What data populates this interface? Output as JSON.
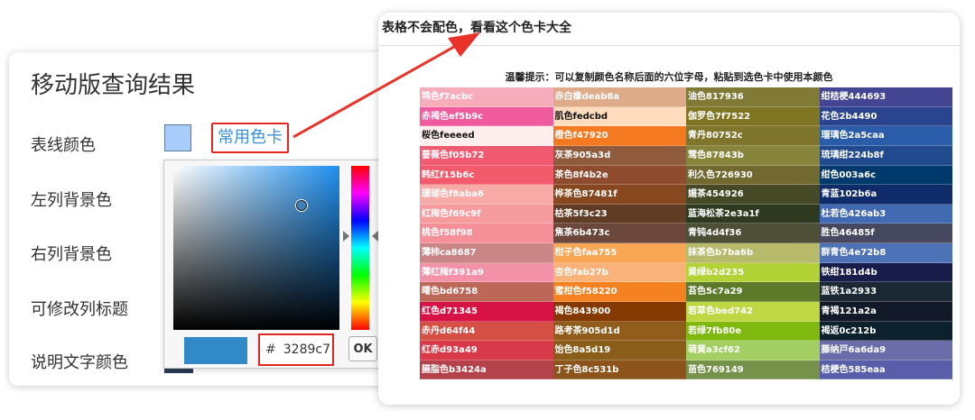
{
  "left_panel": {
    "title": "移动版查询结果",
    "labels": [
      "表线颜色",
      "左列背景色",
      "右列背景色",
      "可修改列标题",
      "说明文字颜色"
    ],
    "common_colors_link": "常用色卡",
    "picker": {
      "hash": "#",
      "hex_value": "3289c7",
      "ok_label": "OK",
      "preview_color": "#3289c7"
    }
  },
  "right_panel": {
    "title": "表格不会配色，看看这个色卡大全",
    "tip": "温馨提示：可以复制颜色名称后面的六位字母，粘贴到选色卡中使用本颜色",
    "columns": [
      [
        {
          "label": "鸨色f7acbc",
          "color": "#f7acbc"
        },
        {
          "label": "赤褐色ef5b9c",
          "color": "#ef5b9c"
        },
        {
          "label": "桜色feeeed",
          "color": "#feeeed",
          "dark": true
        },
        {
          "label": "蔷薇色f05b72",
          "color": "#f05b72"
        },
        {
          "label": "韩红f15b6c",
          "color": "#f15b6c"
        },
        {
          "label": "珊瑚色f8aba6",
          "color": "#f8aba6"
        },
        {
          "label": "红梅色f69c9f",
          "color": "#f69c9f"
        },
        {
          "label": "桃色f58f98",
          "color": "#f58f98"
        },
        {
          "label": "薄柿ca8687",
          "color": "#ca8687"
        },
        {
          "label": "薄红梅f391a9",
          "color": "#f391a9"
        },
        {
          "label": "曙色bd6758",
          "color": "#bd6758"
        },
        {
          "label": "红色d71345",
          "color": "#d71345"
        },
        {
          "label": "赤丹d64f44",
          "color": "#d64f44"
        },
        {
          "label": "红赤d93a49",
          "color": "#d93a49"
        },
        {
          "label": "臙脂色b3424a",
          "color": "#b3424a"
        }
      ],
      [
        {
          "label": "赤白橡deab8a",
          "color": "#deab8a"
        },
        {
          "label": "肌色fedcbd",
          "color": "#fedcbd",
          "dark": true
        },
        {
          "label": "橙色f47920",
          "color": "#f47920"
        },
        {
          "label": "灰茶905a3d",
          "color": "#905a3d"
        },
        {
          "label": "茶色8f4b2e",
          "color": "#8f4b2e"
        },
        {
          "label": "桦茶色87481f",
          "color": "#87481f"
        },
        {
          "label": "枯茶5f3c23",
          "color": "#5f3c23"
        },
        {
          "label": "焦茶6b473c",
          "color": "#6b473c"
        },
        {
          "label": "柑子色faa755",
          "color": "#faa755"
        },
        {
          "label": "杏色fab27b",
          "color": "#fab27b"
        },
        {
          "label": "蜜柑色f58220",
          "color": "#f58220"
        },
        {
          "label": "褐色843900",
          "color": "#843900"
        },
        {
          "label": "路考茶905d1d",
          "color": "#905d1d"
        },
        {
          "label": "饴色8a5d19",
          "color": "#8a5d19"
        },
        {
          "label": "丁子色8c531b",
          "color": "#8c531b"
        }
      ],
      [
        {
          "label": "油色817936",
          "color": "#817936"
        },
        {
          "label": "伽罗色7f7522",
          "color": "#7f7522"
        },
        {
          "label": "青丹80752c",
          "color": "#80752c"
        },
        {
          "label": "莺色87843b",
          "color": "#87843b"
        },
        {
          "label": "利久色726930",
          "color": "#726930"
        },
        {
          "label": "媚茶454926",
          "color": "#454926"
        },
        {
          "label": "蓝海松茶2e3a1f",
          "color": "#2e3a1f"
        },
        {
          "label": "青钝4d4f36",
          "color": "#4d4f36"
        },
        {
          "label": "抹茶色b7ba6b",
          "color": "#b7ba6b"
        },
        {
          "label": "黄绿b2d235",
          "color": "#b2d235"
        },
        {
          "label": "苔色5c7a29",
          "color": "#5c7a29"
        },
        {
          "label": "若草色bed742",
          "color": "#bed742"
        },
        {
          "label": "若绿7fb80e",
          "color": "#7fb80e"
        },
        {
          "label": "萌黄a3cf62",
          "color": "#a3cf62"
        },
        {
          "label": "苗色769149",
          "color": "#769149"
        }
      ],
      [
        {
          "label": "绀桔梗444693",
          "color": "#444693"
        },
        {
          "label": "花色2b4490",
          "color": "#2b4490"
        },
        {
          "label": "瑠璃色2a5caa",
          "color": "#2a5caa"
        },
        {
          "label": "琉璃绀224b8f",
          "color": "#224b8f"
        },
        {
          "label": "绀色003a6c",
          "color": "#003a6c"
        },
        {
          "label": "青蓝102b6a",
          "color": "#102b6a"
        },
        {
          "label": "杜若色426ab3",
          "color": "#426ab3"
        },
        {
          "label": "胜色46485f",
          "color": "#46485f"
        },
        {
          "label": "群青色4e72b8",
          "color": "#4e72b8"
        },
        {
          "label": "铁绀181d4b",
          "color": "#181d4b"
        },
        {
          "label": "蓝铁1a2933",
          "color": "#1a2933"
        },
        {
          "label": "青褐121a2a",
          "color": "#121a2a"
        },
        {
          "label": "褐返0c212b",
          "color": "#0c212b"
        },
        {
          "label": "藤纳戸6a6da9",
          "color": "#6a6da9"
        },
        {
          "label": "桔梗色585eaa",
          "color": "#585eaa"
        }
      ]
    ]
  },
  "colors": {
    "accent_red": "#e3261f",
    "link_blue": "#3b8fd8",
    "line_color_swatch": "#a8cdfb"
  }
}
